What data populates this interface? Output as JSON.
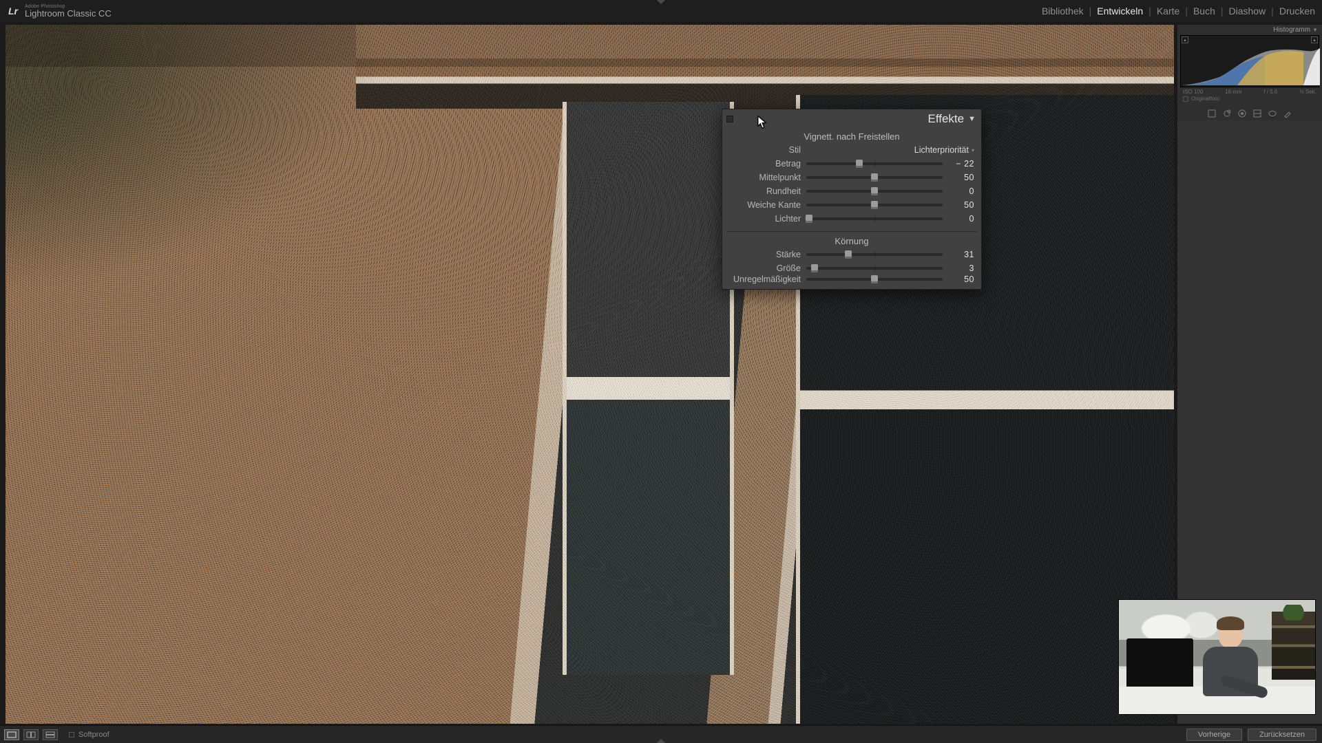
{
  "app": {
    "brand_small": "Adobe Photoshop",
    "brand_big": "Lightroom Classic CC",
    "logo_text": "Lr"
  },
  "modules": {
    "bibliothek": "Bibliothek",
    "entwickeln": "Entwickeln",
    "karte": "Karte",
    "buch": "Buch",
    "diashow": "Diashow",
    "drucken": "Drucken",
    "active": "entwickeln"
  },
  "histogram": {
    "title": "Histogramm",
    "iso": "ISO 100",
    "focal": "16 mm",
    "aperture": "f / 5,6",
    "shutter": "⅛ Sek.",
    "original_label": "Originalfoto"
  },
  "effects_panel": {
    "title": "Effekte",
    "vignette": {
      "title": "Vignett. nach Freistellen",
      "style_label": "Stil",
      "style_value": "Lichterpriorität",
      "betrag_label": "Betrag",
      "betrag_value": "− 22",
      "mittelpunkt_label": "Mittelpunkt",
      "mittelpunkt_value": "50",
      "rundheit_label": "Rundheit",
      "rundheit_value": "0",
      "weiche_label": "Weiche Kante",
      "weiche_value": "50",
      "lichter_label": "Lichter",
      "lichter_value": "0"
    },
    "grain": {
      "title": "Körnung",
      "staerke_label": "Stärke",
      "staerke_value": "31",
      "groesse_label": "Größe",
      "groesse_value": "3",
      "unregel_label": "Unregelmäßigkeit",
      "unregel_value": "50"
    },
    "slider_pos": {
      "betrag": "39%",
      "mittelpunkt": "50%",
      "rundheit": "50%",
      "weiche": "50%",
      "lichter": "2%",
      "staerke": "31%",
      "groesse": "6%",
      "unregel": "50%"
    }
  },
  "bottom": {
    "softproof": "Softproof",
    "prev": "Vorherige",
    "reset": "Zurücksetzen"
  }
}
